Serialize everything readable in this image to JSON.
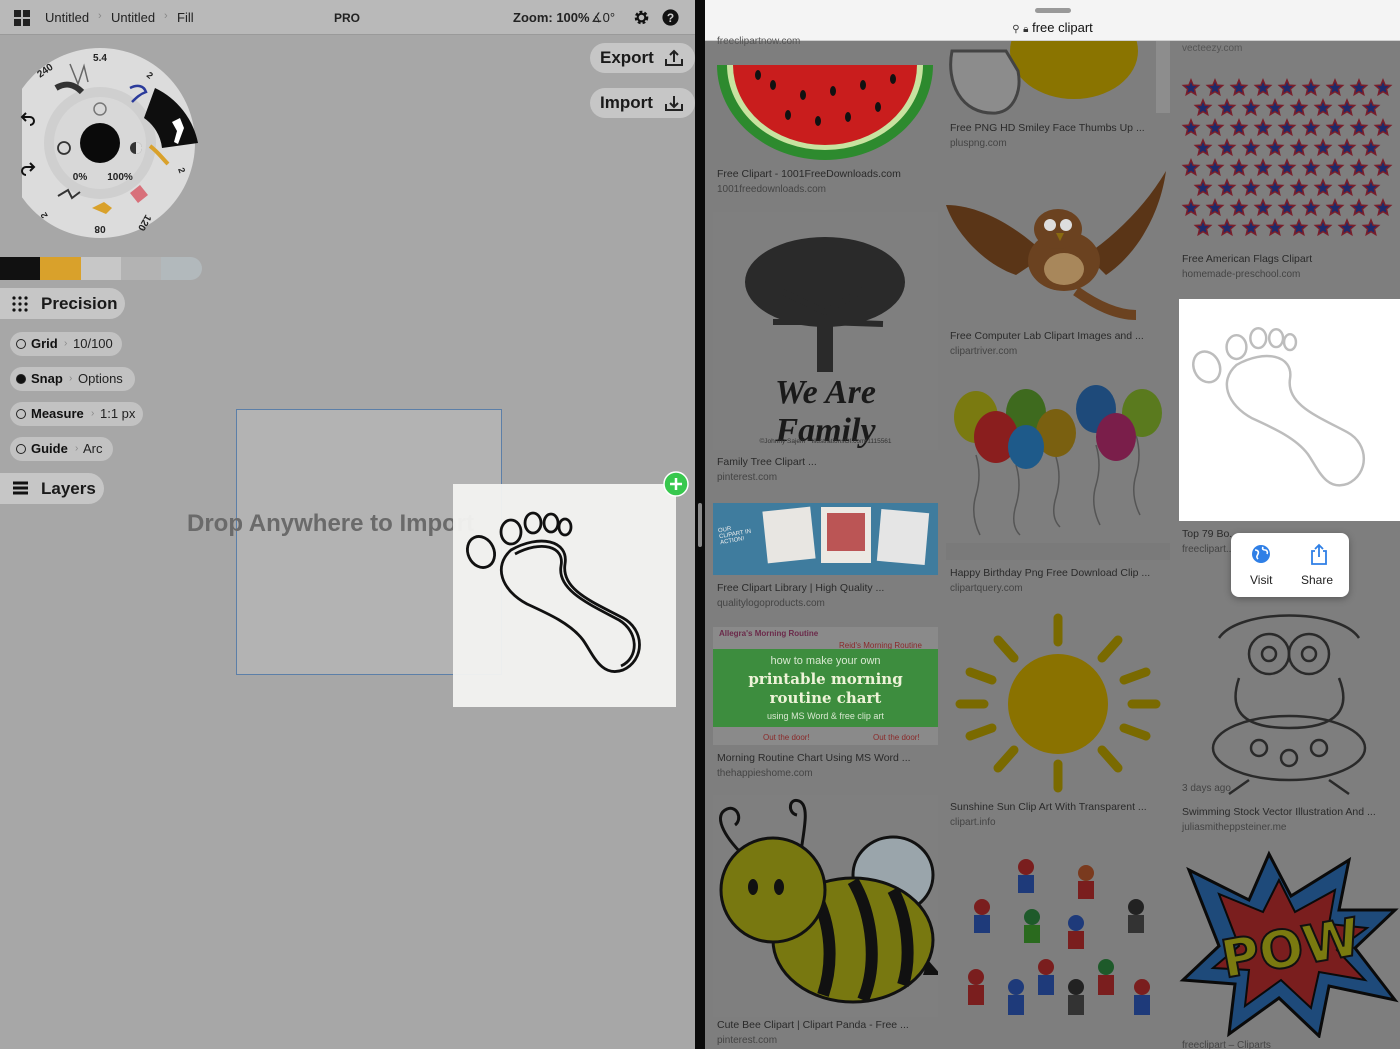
{
  "app": {
    "crumbs": [
      "Untitled",
      "Untitled",
      "Fill"
    ],
    "pro_label": "PRO",
    "zoom_label": "Zoom: 100%",
    "angle_label": "∡0°",
    "export_label": "Export",
    "import_label": "Import",
    "wheel": {
      "size_top": "5.4",
      "size_left": "240",
      "size_right_top": "2",
      "size_right_mid": "2",
      "size_right_bottom": "120",
      "size_bottom": "08",
      "size_left_bottom": "2",
      "opacity_label": "0%",
      "fill_label": "100%"
    },
    "swatches": [
      "#111111",
      "#d9a12b",
      "#c7c7c7",
      "#b3b3b3",
      "#b2b9bc"
    ],
    "precision_label": "Precision",
    "tools": [
      {
        "name": "Grid",
        "value": "10/100",
        "filled": false
      },
      {
        "name": "Snap",
        "value": "Options",
        "filled": true
      },
      {
        "name": "Measure",
        "value": "1:1 px",
        "filled": false
      },
      {
        "name": "Guide",
        "value": "Arc",
        "filled": false
      }
    ],
    "layers_label": "Layers",
    "drop_hint": "Drop Anywhere to Import"
  },
  "browser": {
    "url": "free clipart",
    "results": [
      {
        "caption": "",
        "source": "freeclipartnow.com"
      },
      {
        "caption": "Free Clipart - 1001FreeDownloads.com",
        "source": "1001freedownloads.com"
      },
      {
        "caption": "Family Tree Clipart ...",
        "source": "pinterest.com"
      },
      {
        "caption": "Free Clipart Library | High Quality ...",
        "source": "qualitylogoproducts.com"
      },
      {
        "caption": "Morning Routine Chart Using MS Word ...",
        "source": "thehappieshome.com"
      },
      {
        "caption": "Cute Bee Clipart | Clipart Panda - Free ...",
        "source": "pinterest.com"
      },
      {
        "caption": "Free PNG HD Smiley Face Thumbs Up ...",
        "source": "pluspng.com"
      },
      {
        "caption": "Free Computer Lab Clipart Images and ...",
        "source": "clipartriver.com"
      },
      {
        "caption": "Happy Birthday Png Free Download Clip ...",
        "source": "clipartquery.com"
      },
      {
        "caption": "Sunshine Sun Clip Art With Transparent ...",
        "source": "clipart.info"
      },
      {
        "caption": "",
        "source": "vecteezy.com"
      },
      {
        "caption": "Free American Flags Clipart",
        "source": "homemade-preschool.com"
      },
      {
        "caption": "Top 79 Bo...",
        "source": "freeclipart..."
      },
      {
        "caption": "Swimming Stock Vector Illustration And ...",
        "source": "juliasmitheppsteiner.me"
      },
      {
        "caption": "",
        "source": "freeclipart – Cliparts"
      }
    ],
    "swim_age": "3 days ago",
    "family_text": "We Are Family",
    "family_credit": "©Johnny Sajem  *  IllustrationsOf.com/1115561",
    "routine_lines": [
      "how to make your own",
      "printable morning",
      "routine chart",
      "using MS Word & free clip art"
    ],
    "routine_header_left": "Allegra's Morning Routine",
    "routine_header_right": "Reid's Morning Routine",
    "routine_footer": "Out the door!",
    "library_sign": "OUR CLIPART IN ACTION!",
    "pow_text": "POW",
    "popup": {
      "visit": "Visit",
      "share": "Share"
    }
  }
}
